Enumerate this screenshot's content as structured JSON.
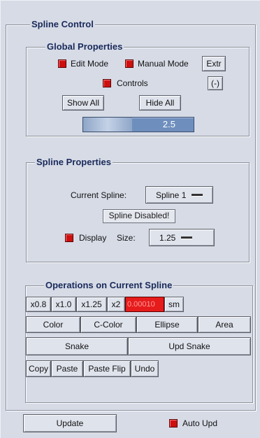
{
  "spline_control": {
    "title": "Spline Control",
    "global": {
      "title": "Global Properties",
      "edit_mode_label": "Edit Mode",
      "edit_mode_checked": true,
      "manual_mode_label": "Manual Mode",
      "manual_mode_checked": true,
      "extr_label": "Extr",
      "controls_label": "Controls",
      "controls_checked": true,
      "minus_label": "(-)",
      "show_all_label": "Show All",
      "hide_all_label": "Hide All",
      "slider_value": "2.5"
    },
    "spline": {
      "title": "Spline Properties",
      "current_spline_label": "Current Spline:",
      "current_spline_value": "Spline 1",
      "status_text": "Spline Disabled!",
      "display_label": "Display",
      "display_checked": true,
      "size_label": "Size:",
      "size_value": "1.25"
    },
    "operations": {
      "title": "Operations on Current Spline",
      "scale_buttons": [
        "x0.8",
        "x1.0",
        "x1.25",
        "x2"
      ],
      "value_field": "0.00010",
      "sm_label": "sm",
      "row2": [
        "Color",
        "C-Color",
        "Ellipse",
        "Area"
      ],
      "snake_label": "Snake",
      "upd_snake_label": "Upd Snake",
      "row4": [
        "Copy",
        "Paste",
        "Paste Flip",
        "Undo"
      ]
    },
    "footer": {
      "update_label": "Update",
      "auto_upd_label": "Auto Upd",
      "auto_upd_checked": true
    }
  }
}
